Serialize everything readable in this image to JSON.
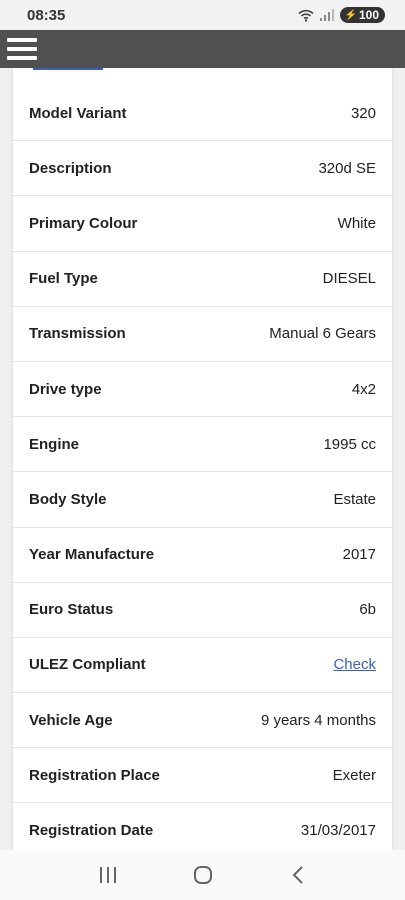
{
  "status_bar": {
    "time": "08:35",
    "battery": "100",
    "icons": [
      "wifi-icon",
      "signal-icon",
      "battery-icon"
    ]
  },
  "app_bar": {
    "menu_icon": "hamburger-menu-icon",
    "background": "#505050"
  },
  "vehicle_details": [
    {
      "label": "Model Variant",
      "value": "320"
    },
    {
      "label": "Description",
      "value": "320d SE"
    },
    {
      "label": "Primary Colour",
      "value": "White"
    },
    {
      "label": "Fuel Type",
      "value": "DIESEL"
    },
    {
      "label": "Transmission",
      "value": "Manual 6 Gears"
    },
    {
      "label": "Drive type",
      "value": "4x2"
    },
    {
      "label": "Engine",
      "value": "1995 cc"
    },
    {
      "label": "Body Style",
      "value": "Estate"
    },
    {
      "label": "Year Manufacture",
      "value": "2017"
    },
    {
      "label": "Euro Status",
      "value": "6b"
    },
    {
      "label": "ULEZ Compliant",
      "value": "Check"
    },
    {
      "label": "Vehicle Age",
      "value": "9 years 4 months"
    },
    {
      "label": "Registration Place",
      "value": "Exeter"
    },
    {
      "label": "Registration Date",
      "value": "31/03/2017"
    }
  ],
  "colors": {
    "link": "#3a5fbf",
    "text": "#222222"
  },
  "nav_bar": {
    "buttons": [
      "recent-apps-icon",
      "home-icon",
      "back-icon"
    ]
  }
}
